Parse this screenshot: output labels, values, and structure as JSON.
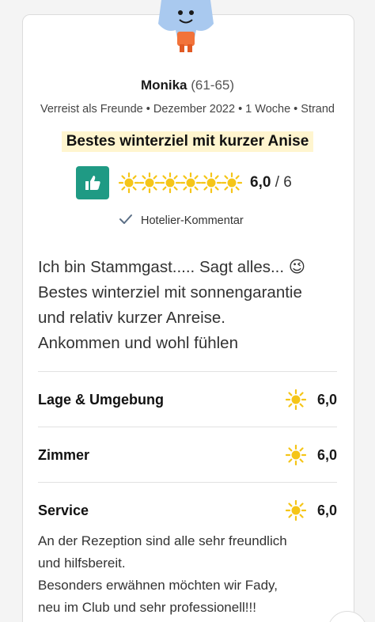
{
  "reviewer": {
    "name": "Monika",
    "age_range": "(61-65)"
  },
  "trip_meta": "Verreist als Freunde • Dezember 2022 • 1 Woche • Strand",
  "review_title": "Bestes winterziel mit kurzer Anise",
  "rating": {
    "suns": 6,
    "value": "6,0",
    "max": "/ 6",
    "thumb_icon": "thumbs-up-icon",
    "accent_color": "#1f9a84",
    "sun_color": "#f5c518"
  },
  "hotelier_label": "Hotelier-Kommentar",
  "review_text": {
    "line1": "Ich bin Stammgast..... Sagt alles... 😉",
    "line2": "Bestes winterziel mit sonnengarantie",
    "line3": "und relativ kurzer Anreise.",
    "line4": "Ankommen und wohl fühlen"
  },
  "categories": [
    {
      "label": "Lage & Umgebung",
      "score": "6,0"
    },
    {
      "label": "Zimmer",
      "score": "6,0"
    },
    {
      "label": "Service",
      "score": "6,0"
    }
  ],
  "service_comment": {
    "line1": "An der Rezeption sind alle sehr freundlich",
    "line2": "und hilfsbereit.",
    "line3": "Besonders erwähnen möchten wir Fady,",
    "line4": "neu im Club und sehr professionell!!!"
  }
}
